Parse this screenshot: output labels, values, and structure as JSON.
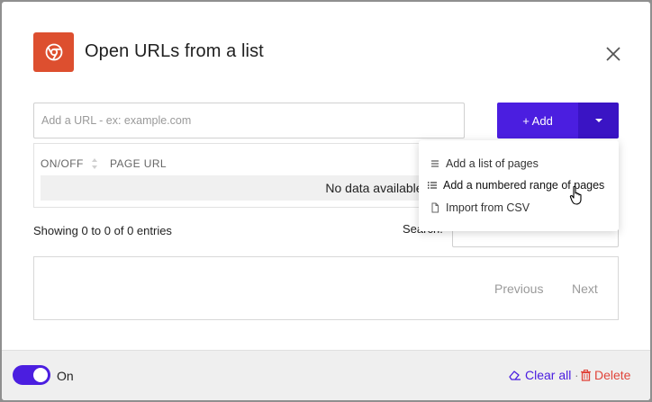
{
  "dialog": {
    "title": "Open URLs from a list",
    "icon": "chrome-icon",
    "accent": "#4b1ee0",
    "icon_color": "#dd4f2f"
  },
  "url_input": {
    "placeholder": "Add a URL - ex: example.com",
    "value": ""
  },
  "add_button": {
    "label": "+ Add"
  },
  "table": {
    "columns": [
      "ON/OFF",
      "PAGE URL"
    ],
    "empty_text": "No data available in table"
  },
  "dropdown": {
    "items": [
      {
        "label": "Add a list of pages",
        "icon": "list-icon"
      },
      {
        "label": "Add a numbered range of pages",
        "icon": "numbered-list-icon"
      },
      {
        "label": "Import from CSV",
        "icon": "file-icon"
      }
    ]
  },
  "info": {
    "showing": "Showing 0 to 0 of 0 entries"
  },
  "search": {
    "label": "Search:"
  },
  "pagination": {
    "previous": "Previous",
    "next": "Next"
  },
  "footer": {
    "toggle_label": "On",
    "toggle_on": true,
    "clear_all": "Clear all",
    "separator": "·",
    "delete": "Delete"
  }
}
